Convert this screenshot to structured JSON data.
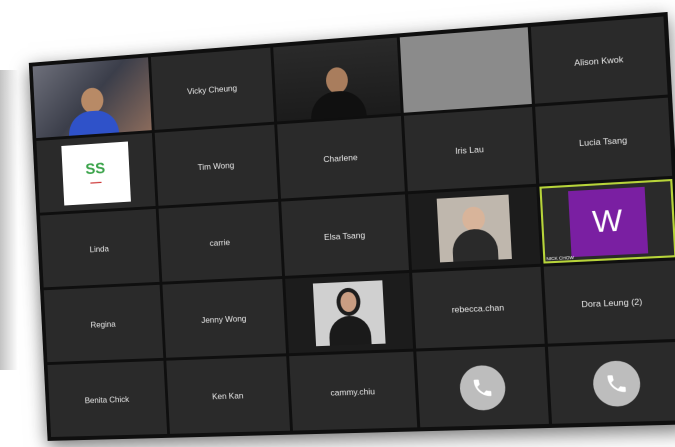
{
  "participants": {
    "vicky": "Vicky Cheung",
    "alison": "Alison Kwok",
    "tim": "Tim Wong",
    "charlene": "Charlene",
    "iris": "Iris Lau",
    "lucia": "Lucia Tsang",
    "linda": "Linda",
    "carrie": "carrie",
    "elsa": "Elsa Tsang",
    "nick": "NICK CHOW",
    "regina": "Regina",
    "jenny": "Jenny Wong",
    "rebecca": "rebecca.chan",
    "dora": "Dora Leung (2)",
    "benita": "Benita Chick",
    "ken": "Ken Kan",
    "cammy": "cammy.chiu"
  },
  "avatar_initial": "W",
  "icons": {
    "call": "phone-icon"
  },
  "colors": {
    "tile": "#2a2a2a",
    "active_border": "#b7d43a",
    "avatar_bg": "#7a1fa2",
    "call_button": "#bdbdbd"
  }
}
